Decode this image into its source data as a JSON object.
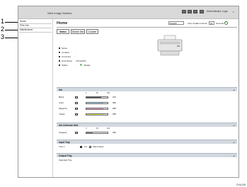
{
  "callouts": [
    "1",
    "2",
    "3"
  ],
  "header": {
    "title": "Web Image Monitor",
    "admin_label": "Administrator Login",
    "admin_arrow": "▾",
    "icons": [
      "printer-icon",
      "help-icon",
      "info-icon",
      "book-icon"
    ]
  },
  "sidebar": {
    "items": [
      {
        "label": "Home"
      },
      {
        "label": "Print Job"
      },
      {
        "label": "Maintenance"
      }
    ]
  },
  "main": {
    "title": "Home",
    "language_select": "English",
    "auto_update_label": "Auto Update Interval",
    "interval_select": "10",
    "seconds_label": "seconds",
    "tabs": [
      {
        "label": "Status",
        "active": true
      },
      {
        "label": "Device Info",
        "active": false
      },
      {
        "label": "Counter",
        "active": false
      }
    ],
    "info": [
      {
        "label": "Name",
        "value": ":"
      },
      {
        "label": "Location",
        "value": ":"
      },
      {
        "label": "Comment",
        "value": ":"
      },
      {
        "label": "Host Name",
        "value": ": Printer001"
      },
      {
        "label": "Status",
        "value": ":"
      }
    ],
    "status_value": "Ready"
  },
  "sections": {
    "ink": {
      "title": "Ink",
      "scale": [
        "0",
        "50",
        "100"
      ],
      "rows": [
        {
          "label": "Black",
          "percent": 0.7,
          "percent_text": "070",
          "color": "#555555"
        },
        {
          "label": "Cyan",
          "percent": 0.8,
          "percent_text": "080",
          "color": "#a9e1f2"
        },
        {
          "label": "Magenta",
          "percent": 0.8,
          "percent_text": "080",
          "color": "#f29ad0"
        },
        {
          "label": "Yellow",
          "percent": 0.8,
          "percent_text": "080",
          "color": "#f3ef6a"
        }
      ]
    },
    "collector": {
      "title": "Ink Collector Unit",
      "scale": [
        "0",
        "50",
        "100"
      ],
      "rows": [
        {
          "label": "Capacity",
          "percent": 0.3,
          "percent_text": "030",
          "color": "#8e8e8e"
        }
      ]
    },
    "input_tray": {
      "title": "Input Tray",
      "tray_label": "Tray 1",
      "size": "A4",
      "paper": "Plain Paper"
    },
    "output_tray": {
      "title": "Output Tray",
      "tray_label": "Standard Tray"
    }
  },
  "footer_code": "CHU128"
}
